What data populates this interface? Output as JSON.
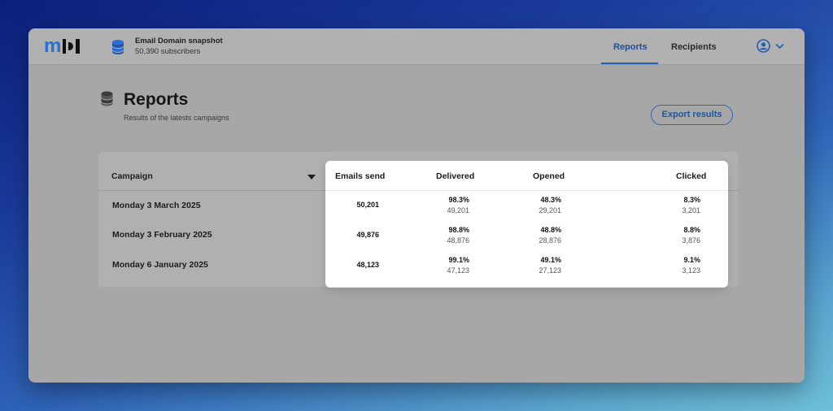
{
  "brand": {
    "logo_text": "m"
  },
  "snapshot": {
    "title": "Email Domain snapshot",
    "subscribers": "50,390 subscribers"
  },
  "nav": {
    "tabs": [
      {
        "label": "Reports",
        "active": true
      },
      {
        "label": "Recipients",
        "active": false
      }
    ]
  },
  "page": {
    "title": "Reports",
    "subtitle": "Results of the latests campaigns"
  },
  "export_label": "Export results",
  "table": {
    "headers": [
      "Campaign",
      "Emails send",
      "Delivered",
      "Opened",
      "Clicked"
    ],
    "rows": [
      {
        "campaign": "Monday 3 March 2025",
        "emails": "50,201",
        "delivered_pct": "98.3%",
        "delivered": "49,201",
        "opened_pct": "48.3%",
        "opened": "29,201",
        "clicked_pct": "8.3%",
        "clicked": "3,201"
      },
      {
        "campaign": "Monday 3 February 2025",
        "emails": "49,876",
        "delivered_pct": "98.8%",
        "delivered": "48,876",
        "opened_pct": "48.8%",
        "opened": "28,876",
        "clicked_pct": "8.8%",
        "clicked": "3,876"
      },
      {
        "campaign": "Monday 6 January 2025",
        "emails": "48,123",
        "delivered_pct": "99.1%",
        "delivered": "47,123",
        "opened_pct": "49.1%",
        "opened": "27,123",
        "clicked_pct": "9.1%",
        "clicked": "3,123"
      }
    ]
  },
  "icons": {
    "database": "database-icon",
    "user": "user-circle-icon",
    "chevron": "chevron-down-icon",
    "sort": "sort-down-icon"
  },
  "colors": {
    "accent": "#1f5fb5",
    "brand_blue": "#2a6fd6"
  }
}
